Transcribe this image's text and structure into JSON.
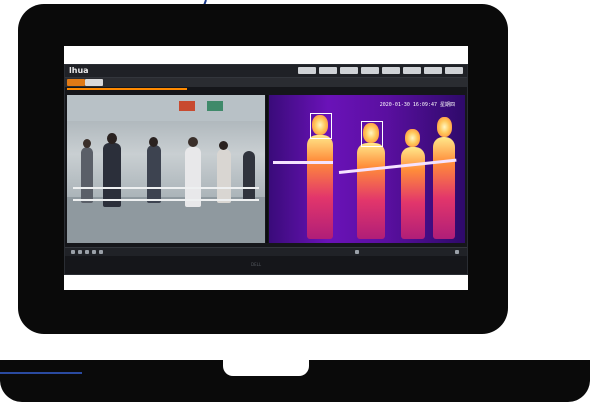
{
  "app": {
    "brand": "lhua",
    "timestamp": "2020-01-30 16:09:47 星期四",
    "top_menu": [
      "",
      "",
      "",
      "",
      "",
      "",
      "",
      ""
    ],
    "tabs": [
      {
        "label": ""
      },
      {
        "label": ""
      },
      {
        "label": ""
      }
    ],
    "bezel_brand": "DELL"
  },
  "colors": {
    "accent": "#e07a16",
    "thermal_bg": "#5a0fa0",
    "laptop": "#0a0a0a"
  },
  "icons": {
    "status_icons": [
      "play-icon",
      "stop-icon",
      "record-icon",
      "snapshot-icon",
      "audio-icon"
    ]
  }
}
